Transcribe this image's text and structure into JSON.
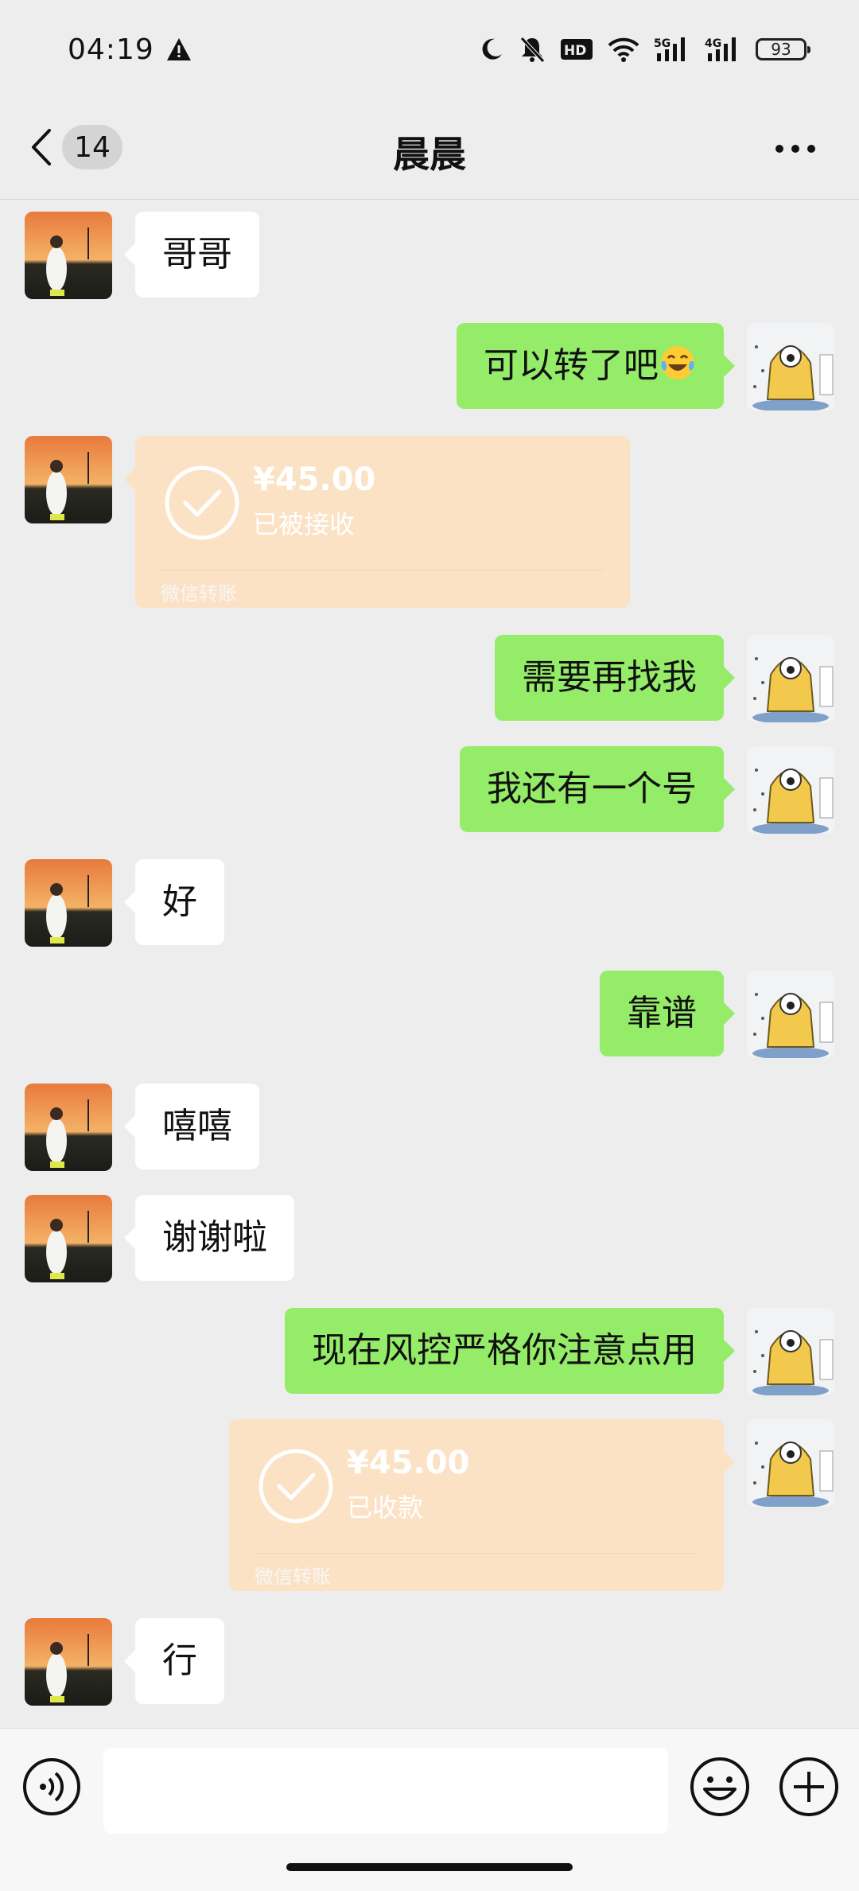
{
  "status_bar": {
    "time": "04:19",
    "battery": "93",
    "icons": [
      "warning-icon",
      "moon-icon",
      "mute-bell-icon",
      "hd-icon",
      "wifi-icon",
      "signal-5g-icon",
      "signal-4g-icon",
      "battery-icon"
    ]
  },
  "nav": {
    "unread_count": "14",
    "title": "晨晨",
    "more_icon": "more-dots-icon"
  },
  "messages": [
    {
      "from": "them",
      "type": "text",
      "text": "哥哥"
    },
    {
      "from": "me",
      "type": "text",
      "text": "可以转了吧",
      "emoji": "tears-of-joy"
    },
    {
      "from": "them",
      "type": "transfer",
      "amount": "¥45.00",
      "status": "已被接收",
      "footer": "微信转账"
    },
    {
      "from": "me",
      "type": "text",
      "text": "需要再找我"
    },
    {
      "from": "me",
      "type": "text",
      "text": "我还有一个号"
    },
    {
      "from": "them",
      "type": "text",
      "text": "好"
    },
    {
      "from": "me",
      "type": "text",
      "text": "靠谱"
    },
    {
      "from": "them",
      "type": "text",
      "text": "嘻嘻"
    },
    {
      "from": "them",
      "type": "text",
      "text": "谢谢啦"
    },
    {
      "from": "me",
      "type": "text",
      "text": "现在风控严格你注意点用"
    },
    {
      "from": "me",
      "type": "transfer",
      "amount": "¥45.00",
      "status": "已收款",
      "footer": "微信转账"
    },
    {
      "from": "them",
      "type": "text",
      "text": "行"
    }
  ],
  "input_bar": {
    "value": "",
    "icons": [
      "voice-icon",
      "emoji-icon",
      "plus-icon"
    ]
  },
  "colors": {
    "background": "#ededed",
    "outgoing_bubble": "#95ec69",
    "incoming_bubble": "#ffffff",
    "transfer_card": "#fce2c5"
  }
}
